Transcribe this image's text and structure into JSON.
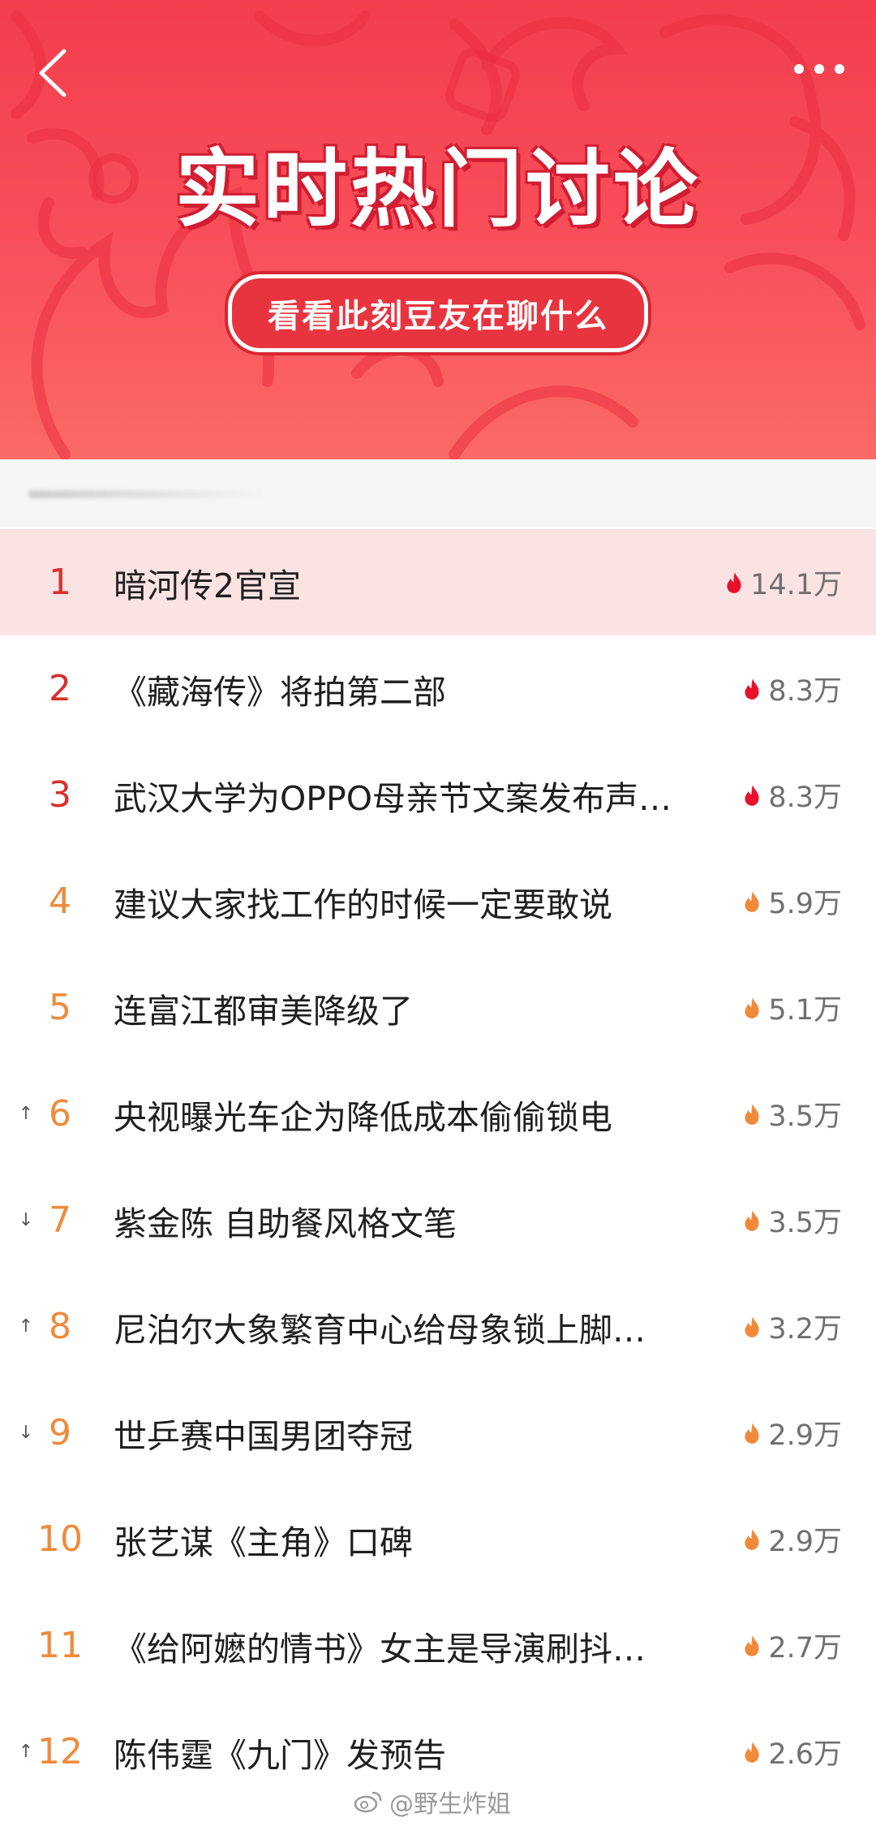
{
  "header": {
    "title": "实时热门讨论",
    "subtitle": "看看此刻豆友在聊什么",
    "back_icon": "chevron-left-icon",
    "more_icon": "more-horizontal-icon"
  },
  "colors": {
    "banner_red": "#f43d4c",
    "rank_top": "#d9302e",
    "rank_mid": "#ef8b3c",
    "flame_red": "#e8112d",
    "flame_orange": "#f08a3a",
    "first_row_bg": "#fbe3e4"
  },
  "topics": [
    {
      "rank": "1",
      "trend": "",
      "title": "暗河传2官宣",
      "heat": "14.1万",
      "tier": "top"
    },
    {
      "rank": "2",
      "trend": "",
      "title": "《藏海传》将拍第二部",
      "heat": "8.3万",
      "tier": "top"
    },
    {
      "rank": "3",
      "trend": "",
      "title": "武汉大学为OPPO母亲节文案发布声…",
      "heat": "8.3万",
      "tier": "top"
    },
    {
      "rank": "4",
      "trend": "",
      "title": "建议大家找工作的时候一定要敢说",
      "heat": "5.9万",
      "tier": "mid"
    },
    {
      "rank": "5",
      "trend": "",
      "title": "连富江都审美降级了",
      "heat": "5.1万",
      "tier": "mid"
    },
    {
      "rank": "6",
      "trend": "↑",
      "title": "央视曝光车企为降低成本偷偷锁电",
      "heat": "3.5万",
      "tier": "mid"
    },
    {
      "rank": "7",
      "trend": "↓",
      "title": "紫金陈 自助餐风格文笔",
      "heat": "3.5万",
      "tier": "mid"
    },
    {
      "rank": "8",
      "trend": "↑",
      "title": "尼泊尔大象繁育中心给母象锁上脚…",
      "heat": "3.2万",
      "tier": "mid"
    },
    {
      "rank": "9",
      "trend": "↓",
      "title": "世乒赛中国男团夺冠",
      "heat": "2.9万",
      "tier": "mid"
    },
    {
      "rank": "10",
      "trend": "",
      "title": "张艺谋《主角》口碑",
      "heat": "2.9万",
      "tier": "mid"
    },
    {
      "rank": "11",
      "trend": "",
      "title": "《给阿嬷的情书》女主是导演刷抖…",
      "heat": "2.7万",
      "tier": "mid"
    },
    {
      "rank": "12",
      "trend": "↑",
      "title": "陈伟霆《九门》发预告",
      "heat": "2.6万",
      "tier": "mid"
    }
  ],
  "watermark": "@野生炸姐"
}
